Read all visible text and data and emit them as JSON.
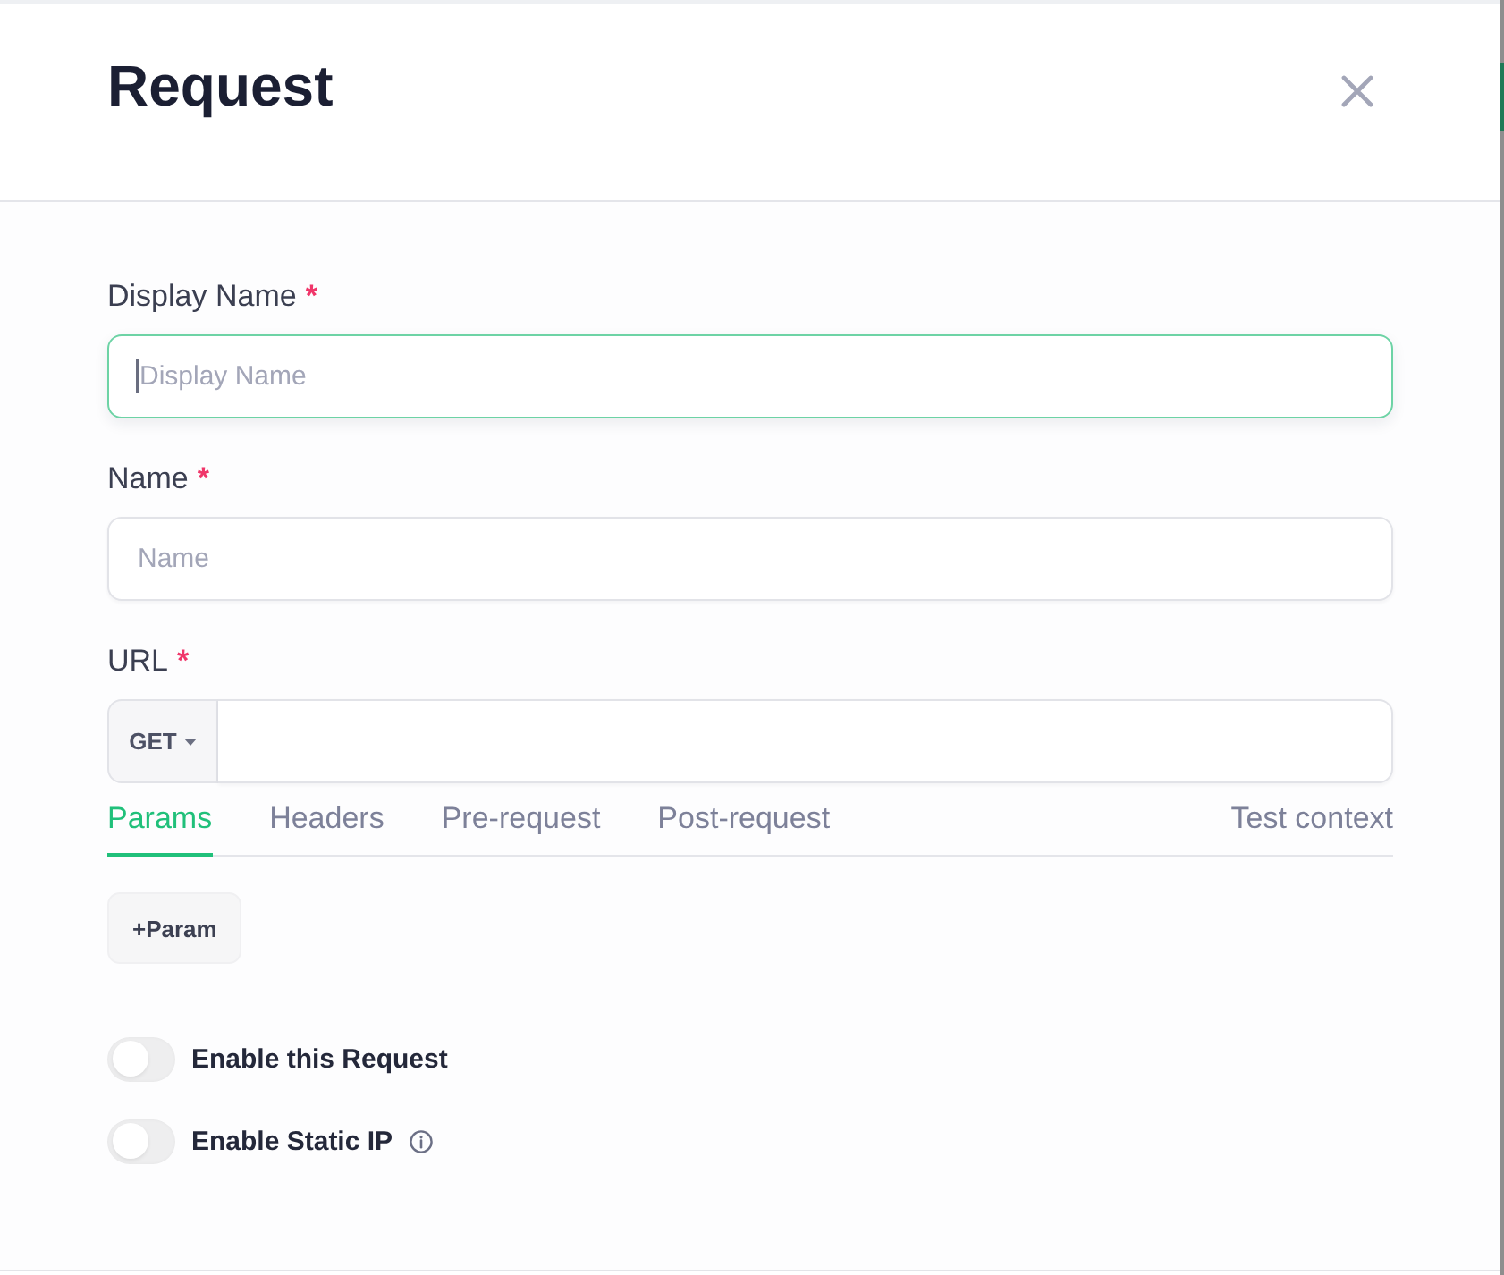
{
  "header": {
    "title": "Request"
  },
  "fields": [
    {
      "label": "Display Name",
      "required_mark": "*",
      "placeholder": "Display Name",
      "focused": true
    },
    {
      "label": "Name",
      "required_mark": "*",
      "placeholder": "Name",
      "focused": false
    }
  ],
  "url": {
    "label": "URL",
    "required_mark": "*",
    "method": "GET"
  },
  "tabs": [
    {
      "label": "Params",
      "selected": true
    },
    {
      "label": "Headers",
      "selected": false
    },
    {
      "label": "Pre-request",
      "selected": false
    },
    {
      "label": "Post-request",
      "selected": false
    }
  ],
  "test_context_link": "Test context",
  "add_param_button": "+Param",
  "toggles": [
    {
      "label": "Enable this Request",
      "on": false,
      "info": false
    },
    {
      "label": "Enable Static IP",
      "on": false,
      "info": true
    }
  ]
}
